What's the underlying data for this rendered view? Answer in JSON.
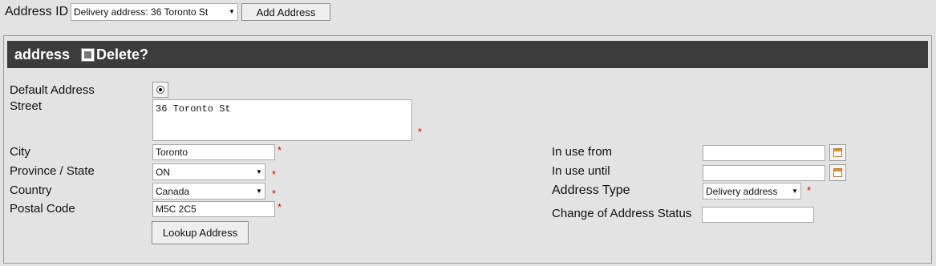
{
  "top": {
    "address_id_label": "Address ID",
    "address_id_value": "Delivery address: 36 Toronto St",
    "add_address_label": "Add Address"
  },
  "section": {
    "title": "address",
    "delete_label": "Delete?"
  },
  "form": {
    "default_address_label": "Default Address",
    "street_label": "Street",
    "street_value": "36 Toronto St",
    "city_label": "City",
    "city_value": "Toronto",
    "province_label": "Province / State",
    "province_value": "ON",
    "country_label": "Country",
    "country_value": "Canada",
    "postal_label": "Postal Code",
    "postal_value": "M5C 2C5",
    "lookup_label": "Lookup Address",
    "in_use_from_label": "In use from",
    "in_use_from_value": "",
    "in_use_until_label": "In use until",
    "in_use_until_value": "",
    "address_type_label": "Address Type",
    "address_type_value": "Delivery address",
    "change_status_label": "Change of Address Status",
    "change_status_value": "",
    "required_mark": "*"
  },
  "icons": {
    "dropdown": "chevron-down-icon",
    "calendar": "calendar-icon",
    "radio": "radio-selected-icon",
    "checkbox": "checkbox-icon"
  },
  "colors": {
    "header_bg": "#3c3c3c",
    "required": "#e00000",
    "page_bg": "#e3e3e3"
  }
}
